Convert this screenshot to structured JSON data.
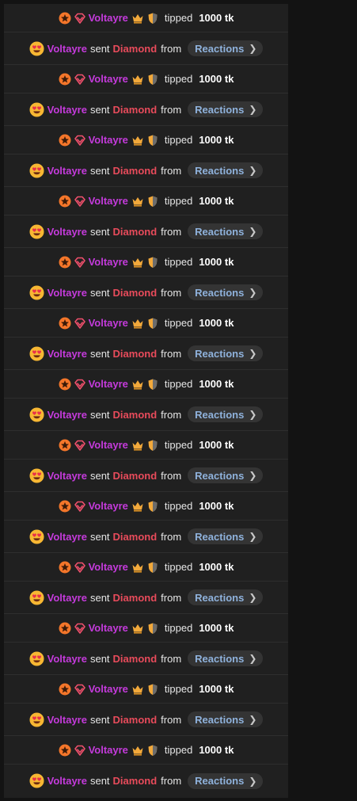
{
  "rows": [
    {
      "type": "tip",
      "user": "Voltayre",
      "action": "tipped",
      "amount": "1000 tk"
    },
    {
      "type": "gift",
      "user": "Voltayre",
      "action": "sent",
      "gift": "Diamond",
      "from_word": "from",
      "source": "Reactions"
    },
    {
      "type": "tip",
      "user": "Voltayre",
      "action": "tipped",
      "amount": "1000 tk"
    },
    {
      "type": "gift",
      "user": "Voltayre",
      "action": "sent",
      "gift": "Diamond",
      "from_word": "from",
      "source": "Reactions"
    },
    {
      "type": "tip",
      "user": "Voltayre",
      "action": "tipped",
      "amount": "1000 tk"
    },
    {
      "type": "gift",
      "user": "Voltayre",
      "action": "sent",
      "gift": "Diamond",
      "from_word": "from",
      "source": "Reactions"
    },
    {
      "type": "tip",
      "user": "Voltayre",
      "action": "tipped",
      "amount": "1000 tk"
    },
    {
      "type": "gift",
      "user": "Voltayre",
      "action": "sent",
      "gift": "Diamond",
      "from_word": "from",
      "source": "Reactions"
    },
    {
      "type": "tip",
      "user": "Voltayre",
      "action": "tipped",
      "amount": "1000 tk"
    },
    {
      "type": "gift",
      "user": "Voltayre",
      "action": "sent",
      "gift": "Diamond",
      "from_word": "from",
      "source": "Reactions"
    },
    {
      "type": "tip",
      "user": "Voltayre",
      "action": "tipped",
      "amount": "1000 tk"
    },
    {
      "type": "gift",
      "user": "Voltayre",
      "action": "sent",
      "gift": "Diamond",
      "from_word": "from",
      "source": "Reactions"
    },
    {
      "type": "tip",
      "user": "Voltayre",
      "action": "tipped",
      "amount": "1000 tk"
    },
    {
      "type": "gift",
      "user": "Voltayre",
      "action": "sent",
      "gift": "Diamond",
      "from_word": "from",
      "source": "Reactions"
    },
    {
      "type": "tip",
      "user": "Voltayre",
      "action": "tipped",
      "amount": "1000 tk"
    },
    {
      "type": "gift",
      "user": "Voltayre",
      "action": "sent",
      "gift": "Diamond",
      "from_word": "from",
      "source": "Reactions"
    },
    {
      "type": "tip",
      "user": "Voltayre",
      "action": "tipped",
      "amount": "1000 tk"
    },
    {
      "type": "gift",
      "user": "Voltayre",
      "action": "sent",
      "gift": "Diamond",
      "from_word": "from",
      "source": "Reactions"
    },
    {
      "type": "tip",
      "user": "Voltayre",
      "action": "tipped",
      "amount": "1000 tk"
    },
    {
      "type": "gift",
      "user": "Voltayre",
      "action": "sent",
      "gift": "Diamond",
      "from_word": "from",
      "source": "Reactions"
    },
    {
      "type": "tip",
      "user": "Voltayre",
      "action": "tipped",
      "amount": "1000 tk"
    },
    {
      "type": "gift",
      "user": "Voltayre",
      "action": "sent",
      "gift": "Diamond",
      "from_word": "from",
      "source": "Reactions"
    },
    {
      "type": "tip",
      "user": "Voltayre",
      "action": "tipped",
      "amount": "1000 tk"
    },
    {
      "type": "gift",
      "user": "Voltayre",
      "action": "sent",
      "gift": "Diamond",
      "from_word": "from",
      "source": "Reactions"
    },
    {
      "type": "tip",
      "user": "Voltayre",
      "action": "tipped",
      "amount": "1000 tk"
    },
    {
      "type": "gift",
      "user": "Voltayre",
      "action": "sent",
      "gift": "Diamond",
      "from_word": "from",
      "source": "Reactions"
    }
  ],
  "icons": {
    "tip_badges": [
      "star-badge-icon",
      "diamond-badge-icon",
      "crown-icon",
      "shield-icon"
    ],
    "gift_emoji": "heart-eyes-emoji-icon",
    "chevron": "chevron-right-icon"
  },
  "colors": {
    "username": "#c53bdc",
    "gift": "#e84b5b",
    "link": "#8fb2dc",
    "row_bg": "#202020"
  }
}
